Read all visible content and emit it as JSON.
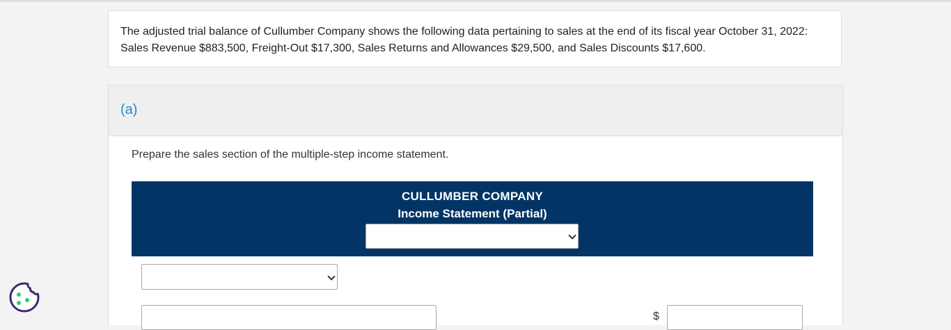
{
  "problem": {
    "text": "The adjusted trial balance of Cullumber Company shows the following data pertaining to sales at the end of its fiscal year October 31, 2022: Sales Revenue $883,500, Freight-Out $17,300, Sales Returns and Allowances $29,500, and Sales Discounts $17,600."
  },
  "part_a": {
    "label": "(a)",
    "instruction": "Prepare the sales section of the multiple-step income statement.",
    "statement": {
      "company": "CULLUMBER COMPANY",
      "title": "Income Statement (Partial)",
      "date_select_value": ""
    },
    "rows": [
      {
        "account_select_value": ""
      },
      {
        "description_value": "",
        "currency": "$",
        "amount_value": ""
      }
    ]
  },
  "colors": {
    "header_bg": "#023565",
    "part_label": "#1a8fd0",
    "cookie_icon": "#3b2a6b",
    "cookie_dots": "#2ecc71"
  },
  "icons": {
    "cookie": "cookie-icon",
    "dropdown": "chevron-down-icon"
  }
}
